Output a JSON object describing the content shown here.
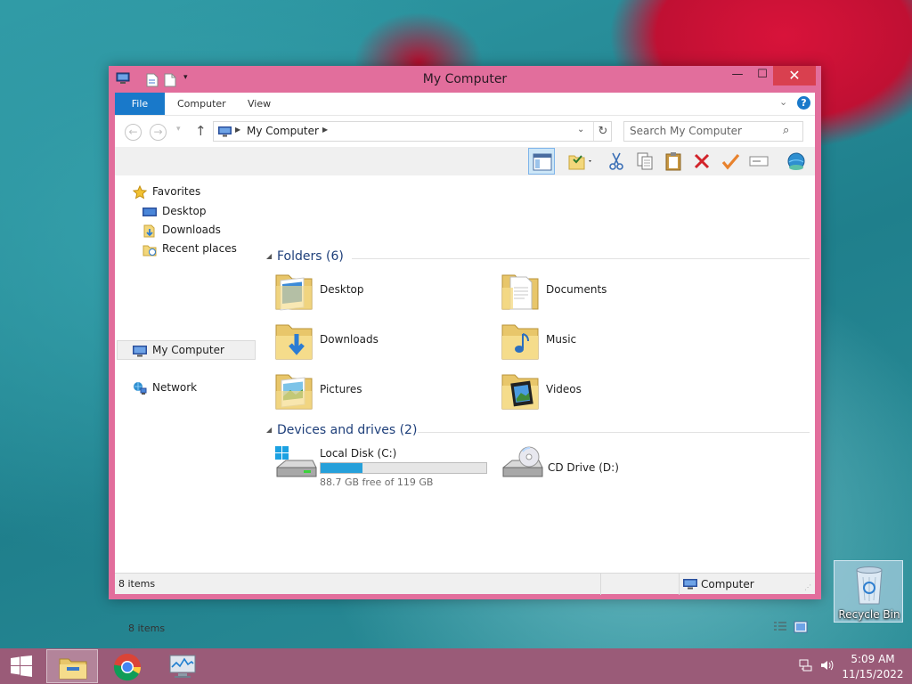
{
  "window": {
    "title": "My Computer",
    "controls": {
      "minimize": "—",
      "maximize": "☐",
      "close": "✕"
    }
  },
  "ribbon": {
    "tabs": [
      {
        "label": "File"
      },
      {
        "label": "Computer"
      },
      {
        "label": "View"
      }
    ],
    "help": "?"
  },
  "navigation": {
    "address": "My Computer",
    "search_placeholder": "Search My Computer"
  },
  "sidebar": {
    "favorites": {
      "label": "Favorites",
      "items": [
        {
          "label": "Desktop"
        },
        {
          "label": "Downloads"
        },
        {
          "label": "Recent places"
        }
      ]
    },
    "computer": {
      "label": "My Computer"
    },
    "network": {
      "label": "Network"
    }
  },
  "main": {
    "folders_header": "Folders (6)",
    "folders": [
      {
        "label": "Desktop",
        "icon": "desktop-folder-icon"
      },
      {
        "label": "Documents",
        "icon": "documents-folder-icon"
      },
      {
        "label": "Downloads",
        "icon": "downloads-folder-icon"
      },
      {
        "label": "Music",
        "icon": "music-folder-icon"
      },
      {
        "label": "Pictures",
        "icon": "pictures-folder-icon"
      },
      {
        "label": "Videos",
        "icon": "videos-folder-icon"
      }
    ],
    "drives_header": "Devices and drives (2)",
    "drives": [
      {
        "label": "Local Disk (C:)",
        "free_text": "88.7 GB free of 119 GB",
        "used_fraction": 0.255
      },
      {
        "label": "CD Drive (D:)"
      }
    ],
    "status": "8 items"
  },
  "statusbar": {
    "items": "8 items",
    "zone": "Computer"
  },
  "desktop": {
    "recycle_bin": "Recycle Bin"
  },
  "taskbar": {
    "time": "5:09 AM",
    "date": "11/15/2022"
  },
  "colors": {
    "window_frame": "#e26e9c",
    "accent": "#1979ca",
    "close_button": "#d9404f",
    "taskbar": "#9a5b78",
    "drive_bar_fill": "#26a0da"
  }
}
